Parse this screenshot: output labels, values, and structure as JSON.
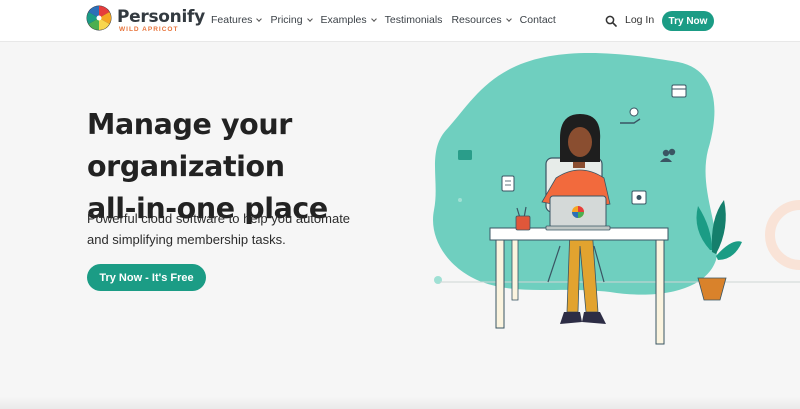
{
  "brand": {
    "name": "Personify",
    "subtitle": "WILD APRICOT",
    "logo_icon": "color-wheel-logo"
  },
  "nav": {
    "items": [
      {
        "label": "Features",
        "has_dropdown": true
      },
      {
        "label": "Pricing",
        "has_dropdown": true
      },
      {
        "label": "Examples",
        "has_dropdown": true
      },
      {
        "label": "Testimonials",
        "has_dropdown": false
      },
      {
        "label": "Resources",
        "has_dropdown": true
      },
      {
        "label": "Contact",
        "has_dropdown": false
      }
    ],
    "search_icon": "search-icon",
    "login_label": "Log In",
    "try_label": "Try Now"
  },
  "hero": {
    "title_line1": "Manage your organization",
    "title_line2": "all-in-one place",
    "subtitle_line1": "Powerful cloud software to help you automate",
    "subtitle_line2": "and simplifying membership tasks.",
    "cta_label": "Try Now - It's Free"
  },
  "colors": {
    "accent": "#1b9c85",
    "blob": "#6fcfbf",
    "brand_orange": "#e8743b",
    "shirt": "#f26a3d",
    "pants": "#e2a32f",
    "plant_pot": "#d9822b"
  }
}
